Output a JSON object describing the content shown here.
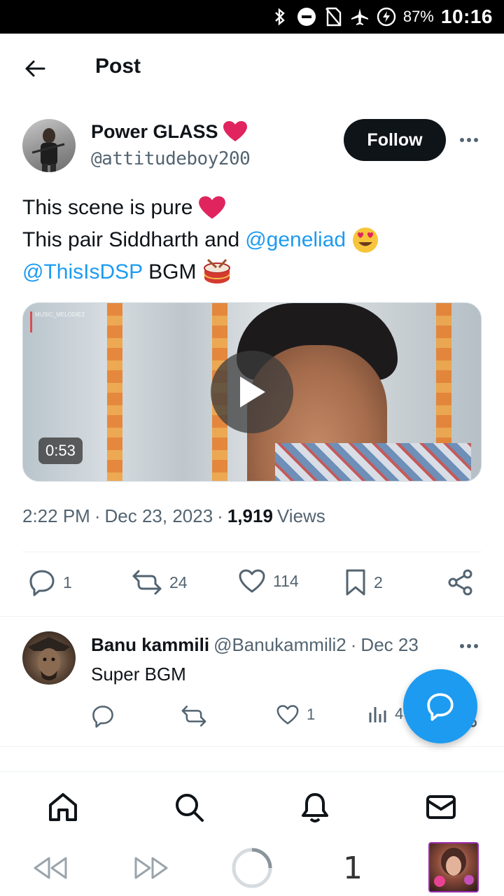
{
  "status_bar": {
    "battery": "87%",
    "time": "10:16"
  },
  "header": {
    "title": "Post"
  },
  "post": {
    "author_name": "Power GLASS",
    "author_handle": "@attitudeboy200",
    "follow_label": "Follow",
    "text_line1": "This scene is pure",
    "text_line2": "This pair Siddharth and",
    "mention1": "@geneliad",
    "mention2": "@ThisIsDSP",
    "text_line3_suffix": "BGM",
    "media_watermark": "MUSIC_MELODIEZ",
    "video_duration": "0:53",
    "time": "2:22 PM",
    "date": "Dec 23, 2023",
    "views_count": "1,919",
    "views_label": "Views",
    "replies": "1",
    "reposts": "24",
    "likes": "114",
    "bookmarks": "2"
  },
  "reply": {
    "name": "Banu kammili",
    "handle": "@Banukammili2",
    "date": "Dec 23",
    "text": "Super BGM",
    "likes": "1",
    "views": "4"
  },
  "controls": {
    "count": "1"
  },
  "colors": {
    "accent": "#1d9bf0",
    "heart": "#e0245e",
    "text": "#0f1419",
    "muted": "#536471"
  }
}
